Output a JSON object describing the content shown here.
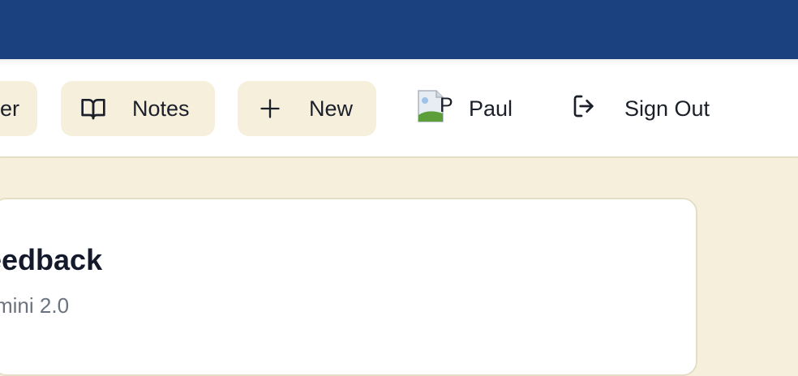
{
  "nav": {
    "partial_button_label": "er",
    "notes_label": "Notes",
    "new_label": "New",
    "avatar_alt": "P",
    "user_name": "Paul",
    "signout_label": "Sign Out"
  },
  "card": {
    "title": "eedback",
    "subtitle": "mini 2.0"
  },
  "colors": {
    "topbar": "#1b427e",
    "button_bg": "#f5efdc",
    "page_bg": "#f5efdc"
  }
}
